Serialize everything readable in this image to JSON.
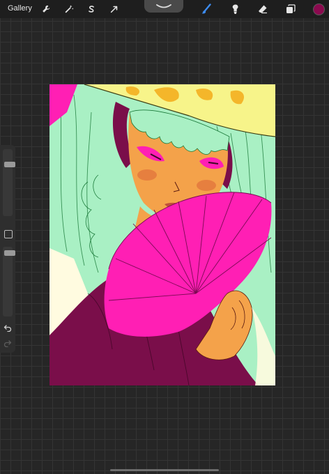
{
  "toolbar": {
    "gallery_label": "Gallery",
    "left_tools": [
      "wrench-icon",
      "magic-wand-icon",
      "selection-s-icon",
      "transform-arrow-icon"
    ],
    "right_tools": [
      "brush-icon",
      "smudge-icon",
      "eraser-icon",
      "layers-icon"
    ],
    "active_tool": "brush-icon",
    "active_color": "#8b0a4f"
  },
  "sidebar": {
    "brush_size_level": 0.2,
    "opacity_level": 0.05,
    "modify_button": "square-icon",
    "undo": "undo-icon",
    "redo": "redo-icon"
  },
  "canvas": {
    "palette": {
      "mint": "#a9f0c4",
      "yellow": "#f7f48a",
      "gold": "#f4b62a",
      "magenta": "#ff1fb4",
      "plum": "#7a0e4a",
      "skin": "#f4a24a",
      "cream": "#fffbe0"
    }
  }
}
